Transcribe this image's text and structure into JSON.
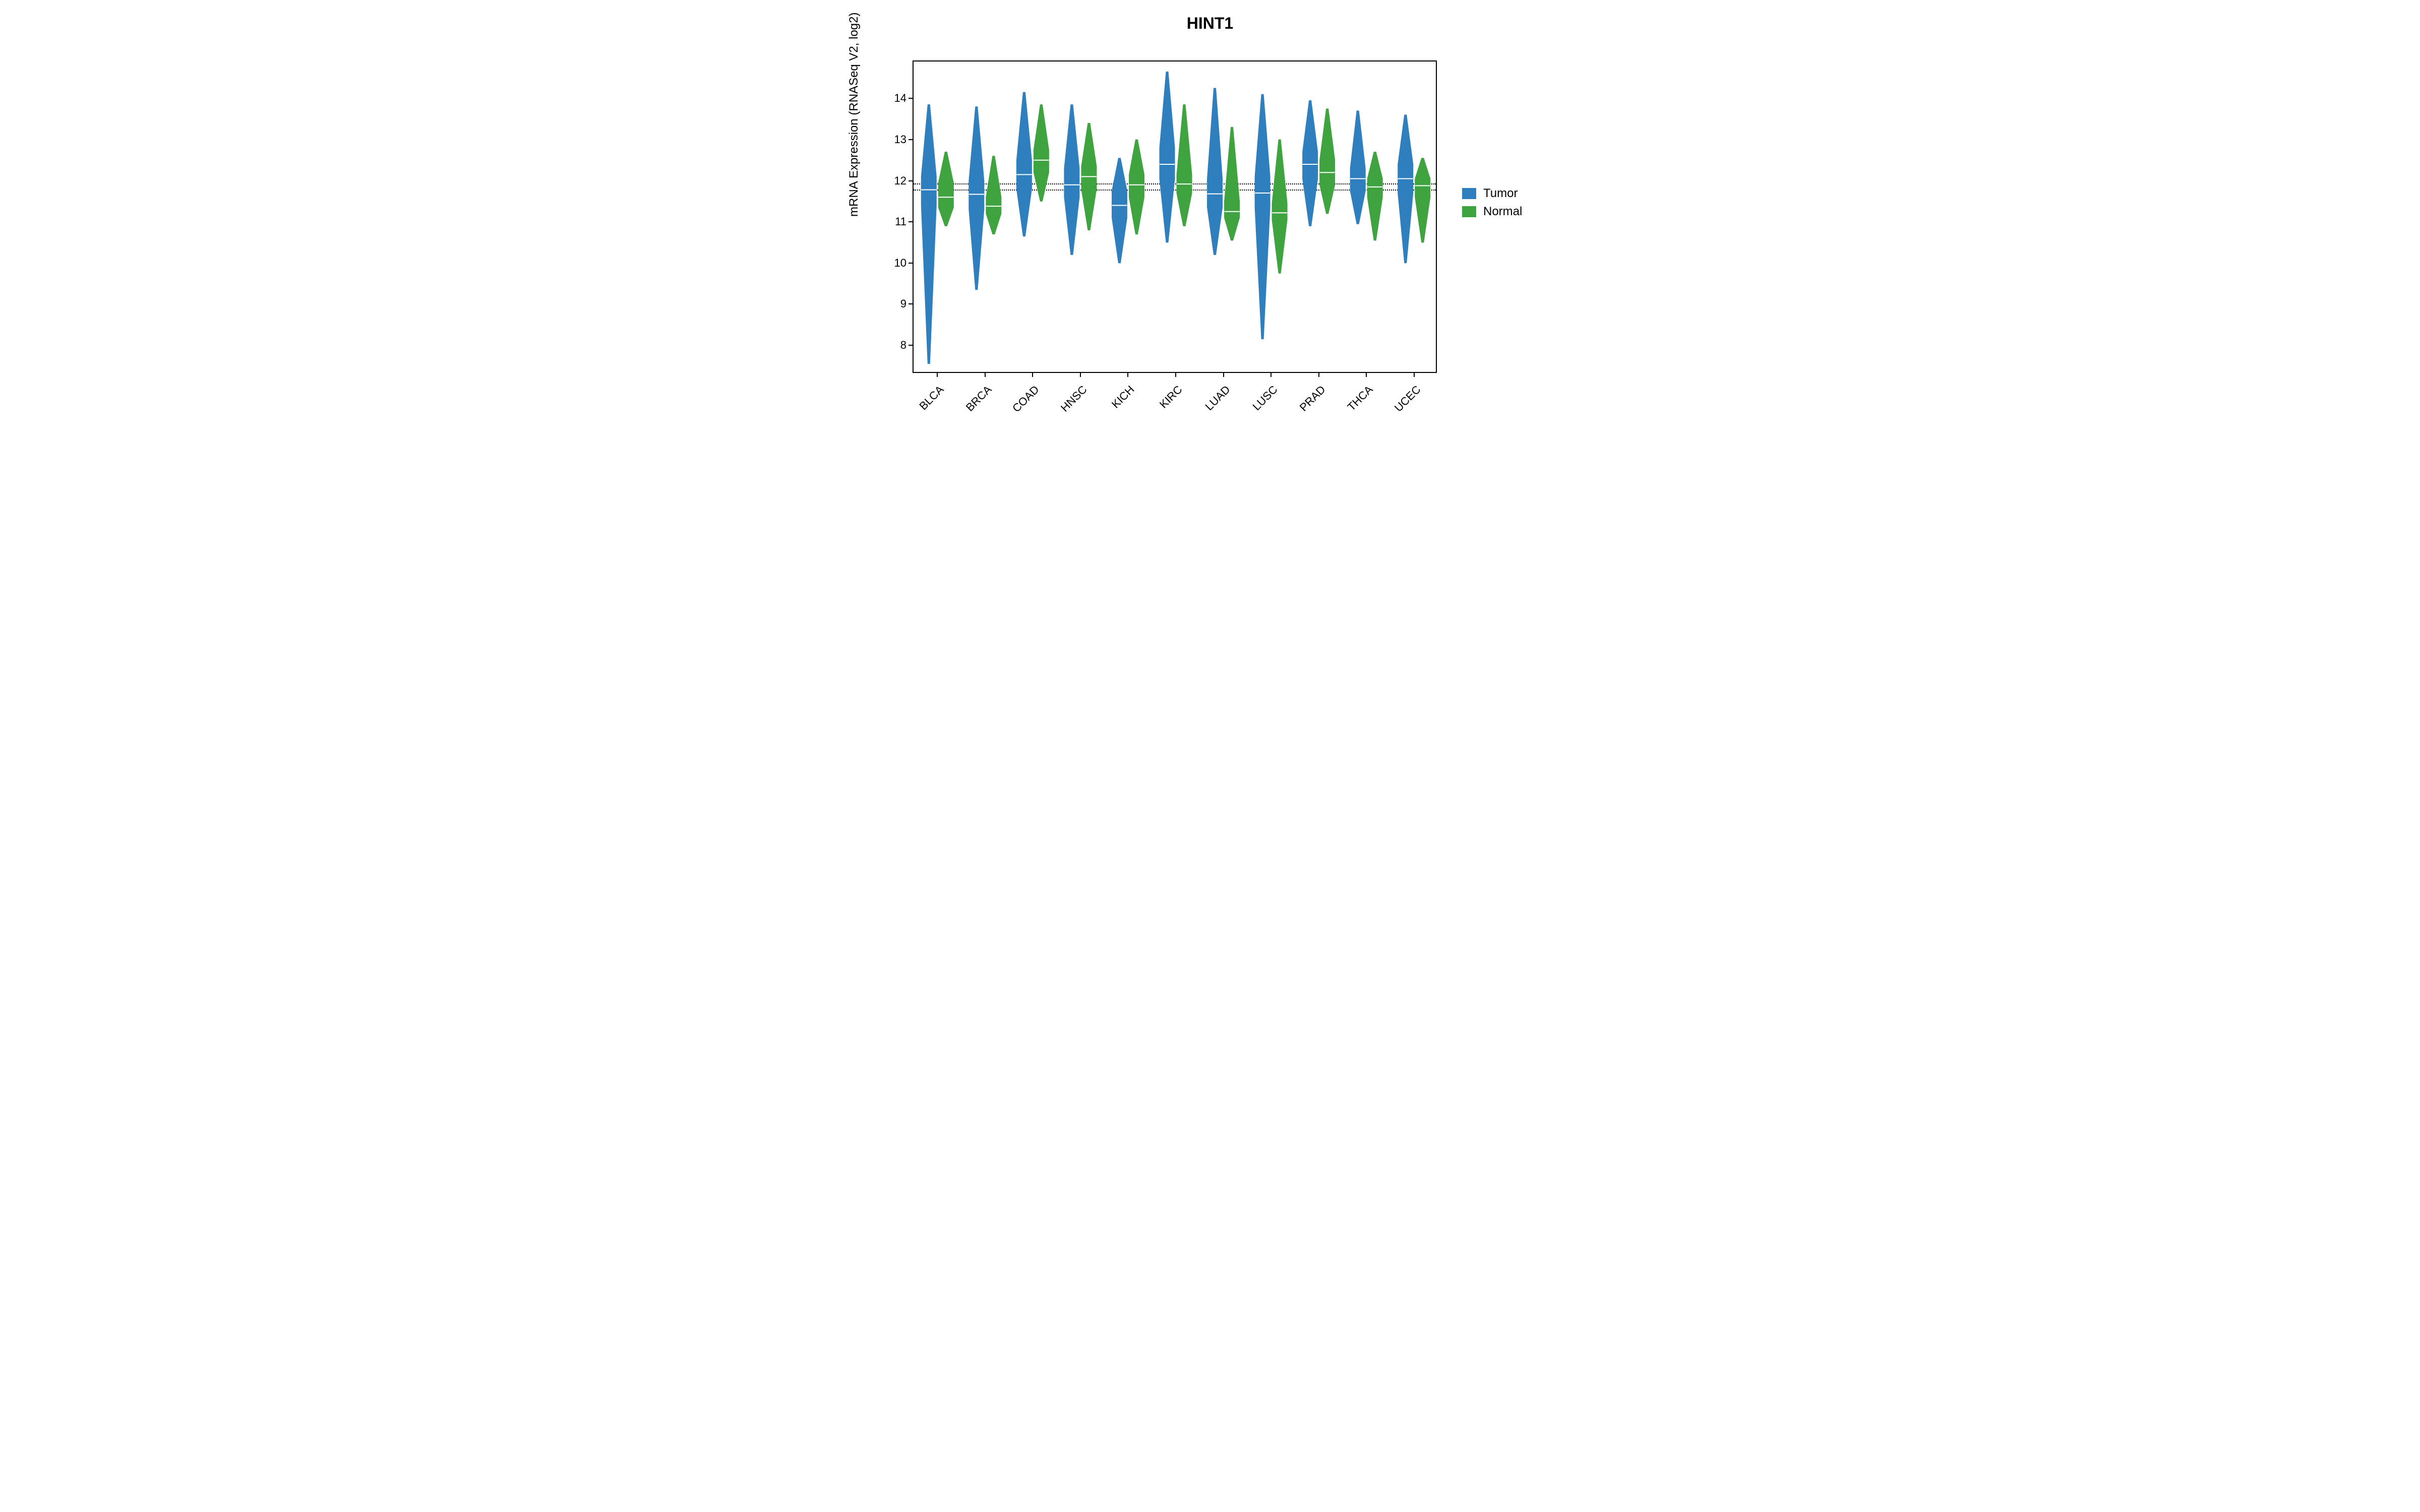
{
  "chart_data": {
    "type": "violin",
    "title": "HINT1",
    "ylabel": "mRNA Expression (RNASeq V2, log2)",
    "xlabel": "",
    "categories": [
      "BLCA",
      "BRCA",
      "COAD",
      "HNSC",
      "KICH",
      "KIRC",
      "LUAD",
      "LUSC",
      "PRAD",
      "THCA",
      "UCEC"
    ],
    "y_ticks": [
      8,
      9,
      10,
      11,
      12,
      13,
      14
    ],
    "ylim": [
      7.3,
      14.9
    ],
    "legend": [
      {
        "name": "Tumor",
        "color": "#2f7fbf"
      },
      {
        "name": "Normal",
        "color": "#3fa33f"
      }
    ],
    "reference_lines": [
      11.78,
      11.92
    ],
    "series": [
      {
        "name": "Tumor",
        "color": "#2f7fbf",
        "stats": {
          "BLCA": {
            "min": 7.55,
            "q1": 11.4,
            "median": 11.78,
            "q3": 12.1,
            "max": 13.85
          },
          "BRCA": {
            "min": 9.35,
            "q1": 11.3,
            "median": 11.67,
            "q3": 12.0,
            "max": 13.8
          },
          "COAD": {
            "min": 10.65,
            "q1": 11.8,
            "median": 12.15,
            "q3": 12.5,
            "max": 14.15
          },
          "HNSC": {
            "min": 10.2,
            "q1": 11.6,
            "median": 11.9,
            "q3": 12.3,
            "max": 13.85
          },
          "KICH": {
            "min": 10.0,
            "q1": 11.1,
            "median": 11.4,
            "q3": 11.75,
            "max": 12.55
          },
          "KIRC": {
            "min": 10.5,
            "q1": 12.05,
            "median": 12.4,
            "q3": 12.8,
            "max": 14.65
          },
          "LUAD": {
            "min": 10.2,
            "q1": 11.35,
            "median": 11.68,
            "q3": 12.05,
            "max": 14.25
          },
          "LUSC": {
            "min": 8.15,
            "q1": 11.35,
            "median": 11.7,
            "q3": 12.1,
            "max": 14.1
          },
          "PRAD": {
            "min": 10.9,
            "q1": 12.05,
            "median": 12.4,
            "q3": 12.7,
            "max": 13.95
          },
          "THCA": {
            "min": 10.95,
            "q1": 11.75,
            "median": 12.05,
            "q3": 12.3,
            "max": 13.7
          },
          "UCEC": {
            "min": 10.0,
            "q1": 11.7,
            "median": 12.05,
            "q3": 12.4,
            "max": 13.6
          }
        }
      },
      {
        "name": "Normal",
        "color": "#3fa33f",
        "stats": {
          "BLCA": {
            "min": 10.9,
            "q1": 11.35,
            "median": 11.6,
            "q3": 11.95,
            "max": 12.7
          },
          "BRCA": {
            "min": 10.7,
            "q1": 11.2,
            "median": 11.38,
            "q3": 11.6,
            "max": 12.6
          },
          "COAD": {
            "min": 11.5,
            "q1": 12.2,
            "median": 12.5,
            "q3": 12.75,
            "max": 13.85
          },
          "HNSC": {
            "min": 10.8,
            "q1": 11.8,
            "median": 12.1,
            "q3": 12.35,
            "max": 13.4
          },
          "KICH": {
            "min": 10.7,
            "q1": 11.6,
            "median": 11.9,
            "q3": 12.15,
            "max": 13.0
          },
          "KIRC": {
            "min": 10.9,
            "q1": 11.7,
            "median": 11.92,
            "q3": 12.15,
            "max": 13.85
          },
          "LUAD": {
            "min": 10.55,
            "q1": 11.1,
            "median": 11.25,
            "q3": 11.5,
            "max": 13.3
          },
          "LUSC": {
            "min": 9.75,
            "q1": 11.05,
            "median": 11.22,
            "q3": 11.45,
            "max": 13.0
          },
          "PRAD": {
            "min": 11.2,
            "q1": 11.9,
            "median": 12.2,
            "q3": 12.5,
            "max": 13.75
          },
          "THCA": {
            "min": 10.55,
            "q1": 11.6,
            "median": 11.85,
            "q3": 12.05,
            "max": 12.7
          },
          "UCEC": {
            "min": 10.5,
            "q1": 11.6,
            "median": 11.88,
            "q3": 12.05,
            "max": 12.55
          }
        }
      }
    ]
  },
  "colors": {
    "tumor": "#2f7fbf",
    "normal": "#3fa33f"
  }
}
